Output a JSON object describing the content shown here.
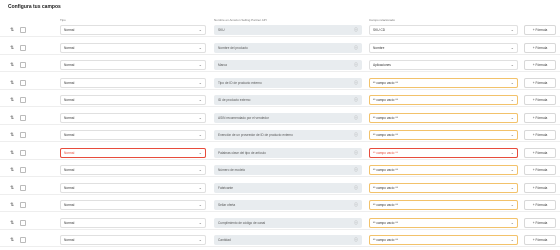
{
  "title": "Configura tus campos",
  "headers": {
    "tipo": "Tipo",
    "amazon": "Nombre en Amazon Selling Partner API",
    "campo": "Campo relacionado"
  },
  "chevron": "⌄",
  "sort_icon": "⇅",
  "info_icon": "ⓘ",
  "formula_label": "+ Fórmula",
  "rows": [
    {
      "tipo": "Normal",
      "amazon": "SKU",
      "campo": "SKU CD",
      "state": "ok"
    },
    {
      "tipo": "Normal",
      "amazon": "Nombre del producto",
      "campo": "Nombre",
      "state": "ok"
    },
    {
      "tipo": "Normal",
      "amazon": "Marca",
      "campo": "Aplicaciones",
      "state": "ok"
    },
    {
      "tipo": "Normal",
      "amazon": "Tipo de ID de producto externo",
      "campo": "** campo vacío **",
      "state": "warn"
    },
    {
      "tipo": "Normal",
      "amazon": "ID de producto externo",
      "campo": "** campo vacío **",
      "state": "warn"
    },
    {
      "tipo": "Normal",
      "amazon": "ASIN recomendado por el vendedor",
      "campo": "** campo vacío **",
      "state": "warn"
    },
    {
      "tipo": "Normal",
      "amazon": "Exención de un proveedor de ID de producto externo",
      "campo": "** campo vacío **",
      "state": "warn"
    },
    {
      "tipo": "Normal",
      "amazon": "Palabras clave del tipo de artículo",
      "campo": "** campo vacío **",
      "state": "err"
    },
    {
      "tipo": "Normal",
      "amazon": "Número de modelo",
      "campo": "** campo vacío **",
      "state": "warn"
    },
    {
      "tipo": "Normal",
      "amazon": "Fabricante",
      "campo": "** campo vacío **",
      "state": "warn"
    },
    {
      "tipo": "Normal",
      "amazon": "Sellar oferta",
      "campo": "** campo vacío **",
      "state": "warn"
    },
    {
      "tipo": "Normal",
      "amazon": "Cumplimiento de código de canal",
      "campo": "** campo vacío **",
      "state": "warn"
    },
    {
      "tipo": "Normal",
      "amazon": "Cantidad",
      "campo": "** campo vacío **",
      "state": "warn"
    }
  ]
}
